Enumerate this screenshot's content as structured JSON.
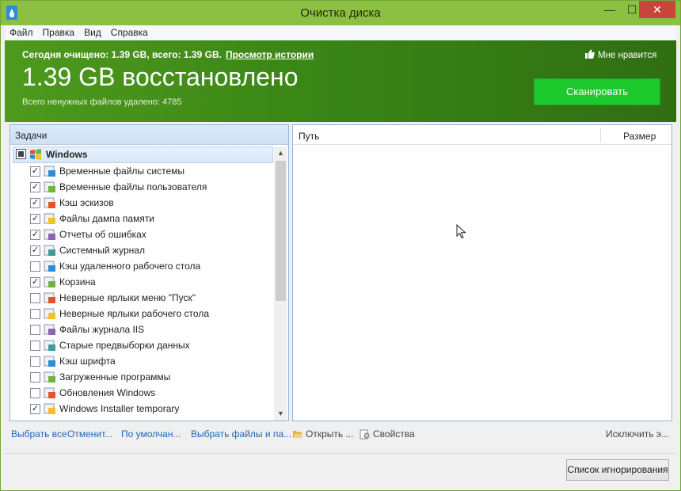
{
  "window": {
    "title": "Очистка диска",
    "minimize": "—",
    "maximize": "☐",
    "close": "✕"
  },
  "menu": [
    "Файл",
    "Правка",
    "Вид",
    "Справка"
  ],
  "banner": {
    "today_text": "Сегодня очищено: 1.39 GB, всего: 1.39 GB.",
    "history_link": "Просмотр истории",
    "like": "Мне нравится",
    "recovered": "1.39 GB восстановлено",
    "deleted_count": "Всего ненужных файлов удалено: 4785",
    "scan_button": "Сканировать"
  },
  "tasks": {
    "header": "Задачи",
    "group": "Windows",
    "items": [
      {
        "label": "Временные файлы системы",
        "checked": true,
        "icon": "windows-temp-icon"
      },
      {
        "label": "Временные файлы пользователя",
        "checked": true,
        "icon": "user-temp-icon"
      },
      {
        "label": "Кэш эскизов",
        "checked": true,
        "icon": "thumbnail-icon"
      },
      {
        "label": "Файлы дампа памяти",
        "checked": true,
        "icon": "memory-dump-icon"
      },
      {
        "label": "Отчеты об ошибках",
        "checked": true,
        "icon": "error-report-icon"
      },
      {
        "label": "Системный журнал",
        "checked": true,
        "icon": "system-log-icon"
      },
      {
        "label": "Кэш удаленного рабочего стола",
        "checked": false,
        "icon": "remote-desktop-icon"
      },
      {
        "label": "Корзина",
        "checked": true,
        "icon": "recycle-bin-icon"
      },
      {
        "label": "Неверные ярлыки меню \"Пуск\"",
        "checked": false,
        "icon": "start-shortcut-icon"
      },
      {
        "label": "Неверные ярлыки рабочего стола",
        "checked": false,
        "icon": "desktop-shortcut-icon"
      },
      {
        "label": "Файлы журнала IIS",
        "checked": false,
        "icon": "iis-log-icon"
      },
      {
        "label": "Старые предвыборки данных",
        "checked": false,
        "icon": "prefetch-icon"
      },
      {
        "label": "Кэш шрифта",
        "checked": false,
        "icon": "font-cache-icon"
      },
      {
        "label": "Загруженные программы",
        "checked": false,
        "icon": "downloaded-programs-icon"
      },
      {
        "label": "Обновления Windows",
        "checked": false,
        "icon": "windows-update-icon"
      },
      {
        "label": "Windows Installer temporary",
        "checked": true,
        "icon": "installer-icon"
      }
    ]
  },
  "results": {
    "col_path": "Путь",
    "col_size": "Размер"
  },
  "actions": {
    "select_all": "Выбрать все",
    "cancel": "Отменит...",
    "default": "По умолчан...",
    "select_files": "Выбрать файлы и па...",
    "open": "Открыть ...",
    "properties": "Свойства",
    "exclude": "Исключить э..."
  },
  "ignore_button": "Список игнорирования",
  "colors": {
    "titlebar": "#8bc043",
    "banner": "#3a8616",
    "scan": "#1ec92d",
    "link": "#1e66b4",
    "close": "#c7463a"
  }
}
